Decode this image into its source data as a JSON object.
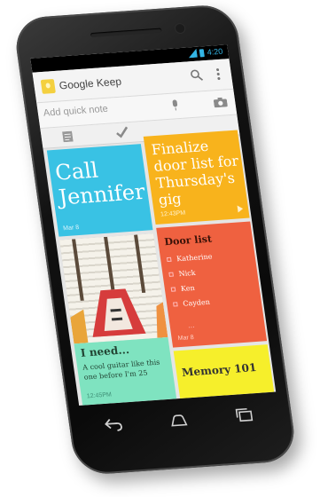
{
  "status_bar": {
    "time": "4:20"
  },
  "app_bar": {
    "title": "Google Keep",
    "search_icon": "search-icon",
    "overflow_icon": "overflow-icon"
  },
  "quick_note": {
    "placeholder": "Add quick note",
    "icons": [
      "mic-icon",
      "camera-icon"
    ]
  },
  "toolbar": {
    "icons": [
      "list-icon",
      "check-icon"
    ]
  },
  "notes": [
    {
      "title": "Call Jennifer",
      "date": "Mar 8",
      "color": "#39c2e4"
    },
    {
      "title": "Finalize door list for Thursday's gig",
      "time": "12:43PM",
      "color": "#f8b31c"
    },
    {
      "image": "guitar-image",
      "title": "I need...",
      "body": "A cool guitar like this one before I'm 25",
      "time": "12:45PM",
      "color": "#7fe3c0"
    },
    {
      "title": "Door list",
      "items": [
        "Katherine",
        "Nick",
        "Ken",
        "Cayden"
      ],
      "more": "...",
      "date": "Mar 8",
      "color": "#ef6140"
    },
    {
      "title": "Memory 101",
      "color": "#f6ef2b"
    }
  ],
  "nav_bar": {
    "icons": [
      "back-icon",
      "home-icon",
      "recent-apps-icon"
    ]
  }
}
